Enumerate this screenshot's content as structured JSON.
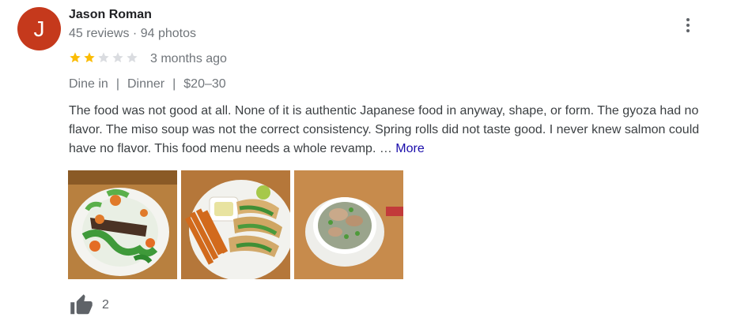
{
  "reviewer": {
    "initial": "J",
    "name": "Jason Roman",
    "meta": "45 reviews · 94 photos"
  },
  "rating": {
    "stars": 2,
    "max": 5
  },
  "time_ago": "3 months ago",
  "tags": [
    "Dine in",
    "Dinner",
    "$20–30"
  ],
  "review_text": "The food was not good at all. None of it is authentic Japanese food in anyway, shape, or form. The gyoza had no flavor. The miso soup was not the correct consistency. Spring rolls did not taste good. I never knew salmon could have no flavor. This food menu needs a whole revamp. …",
  "more_label": "More",
  "like_count": "2",
  "colors": {
    "avatar": "#c5391c",
    "star_filled": "#fbbc04",
    "star_empty": "#dadce0",
    "link": "#1a0dab"
  },
  "icons": [
    "more-vert-icon",
    "star-icon",
    "thumb-up-icon"
  ]
}
